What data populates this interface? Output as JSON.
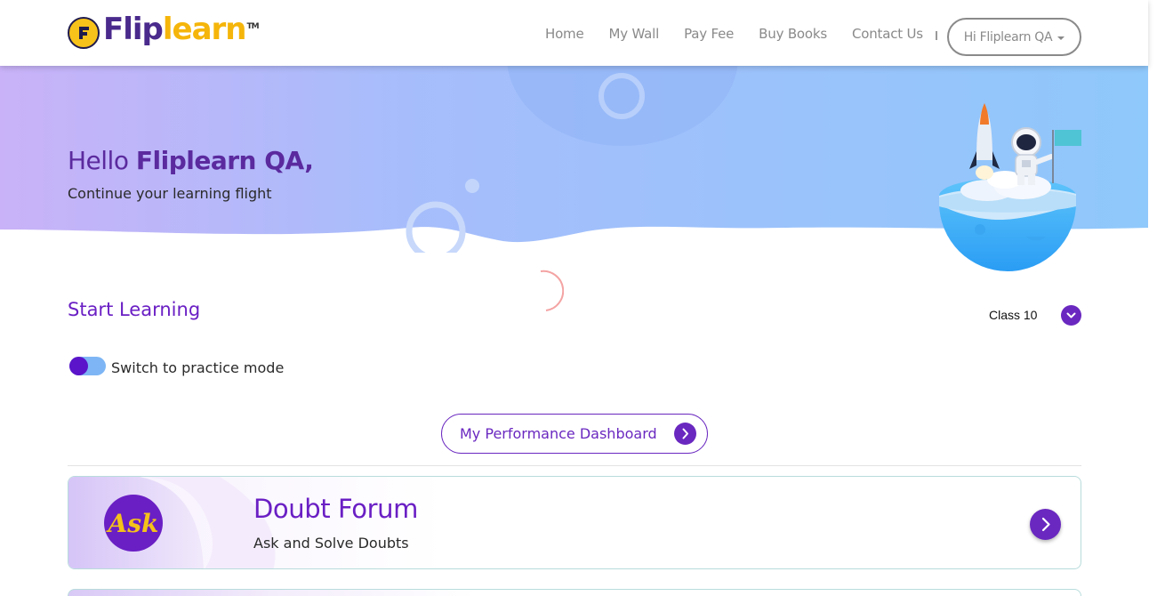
{
  "header": {
    "logo": {
      "text_flip": "Flip",
      "text_learn": "learn",
      "tm": "TM"
    },
    "nav": [
      {
        "label": "Home"
      },
      {
        "label": "My Wall"
      },
      {
        "label": "Pay Fee"
      },
      {
        "label": "Buy Books"
      },
      {
        "label": "Contact Us"
      }
    ],
    "user_menu": {
      "label": "Hi Fliplearn QA"
    }
  },
  "hero": {
    "greeting_prefix": "Hello",
    "greeting_name": "Fliplearn QA,",
    "subtitle": "Continue your learning flight"
  },
  "learning": {
    "title": "Start Learning",
    "class_selector": {
      "value": "Class 10"
    },
    "practice_toggle": {
      "label": "Switch to practice mode",
      "on": false
    },
    "performance_button": {
      "label": "My Performance Dashboard"
    }
  },
  "cards": [
    {
      "icon_text": "Ask",
      "title": "Doubt Forum",
      "subtitle": "Ask and Solve Doubts"
    }
  ],
  "colors": {
    "primary_purple": "#6a1fc4",
    "brand_yellow": "#f5b50a",
    "nav_gray": "#8a8a8a",
    "hero_gradient_start": "#c9b2f8",
    "hero_gradient_end": "#8fc8fb"
  },
  "icons": {
    "class_dropdown": "chevron-down-icon",
    "performance_arrow": "chevron-right-icon",
    "card_arrow": "chevron-right-icon",
    "loading": "spinner-icon",
    "user_caret": "caret-down-icon"
  }
}
